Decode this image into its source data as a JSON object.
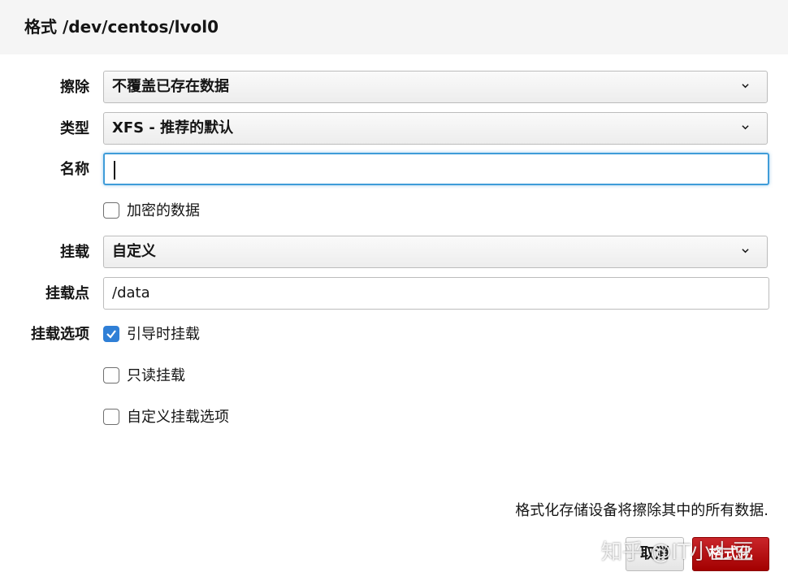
{
  "dialog": {
    "title": "格式 /dev/centos/lvol0"
  },
  "form": {
    "erase": {
      "label": "擦除",
      "value": "不覆盖已存在数据"
    },
    "type": {
      "label": "类型",
      "value": "XFS - 推荐的默认"
    },
    "name": {
      "label": "名称",
      "value": ""
    },
    "encrypt": {
      "label": "加密的数据",
      "checked": false
    },
    "mount": {
      "label": "挂载",
      "value": "自定义"
    },
    "mount_point": {
      "label": "挂载点",
      "value": "/data"
    },
    "mount_options": {
      "label": "挂载选项",
      "items": [
        {
          "label": "引导时挂载",
          "checked": true
        },
        {
          "label": "只读挂载",
          "checked": false
        },
        {
          "label": "自定义挂载选项",
          "checked": false
        }
      ]
    }
  },
  "footer": {
    "warning": "格式化存储设备将擦除其中的所有数据.",
    "cancel_label": "取消",
    "format_label": "格式化"
  },
  "watermark": "知乎 @IT小土豆",
  "colors": {
    "primary_danger": "#c9252a",
    "focus": "#3f9cd9",
    "checkbox_checked": "#2f7fd6"
  }
}
